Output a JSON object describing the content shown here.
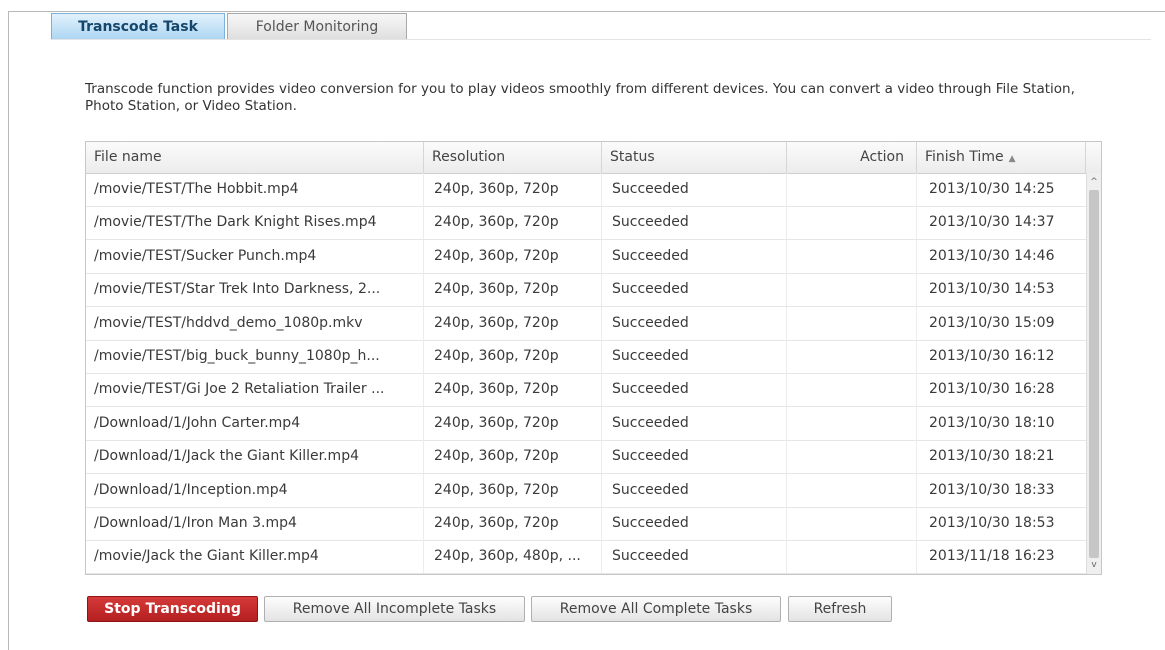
{
  "tabs": {
    "transcode_task": "Transcode Task",
    "folder_monitoring": "Folder Monitoring"
  },
  "description": "Transcode function provides video conversion for you to play videos smoothly from different devices. You can convert a video through File Station, Photo Station, or Video Station.",
  "table": {
    "columns": {
      "file_name": "File name",
      "resolution": "Resolution",
      "status": "Status",
      "action": "Action",
      "finish_time": "Finish Time"
    },
    "sort_indicator": "▲",
    "rows": [
      {
        "file": "/movie/TEST/The Hobbit.mp4",
        "resolution": "240p, 360p, 720p",
        "status": "Succeeded",
        "action": "",
        "finish": "2013/10/30 14:25"
      },
      {
        "file": "/movie/TEST/The Dark Knight Rises.mp4",
        "resolution": "240p, 360p, 720p",
        "status": "Succeeded",
        "action": "",
        "finish": "2013/10/30 14:37"
      },
      {
        "file": "/movie/TEST/Sucker Punch.mp4",
        "resolution": "240p, 360p, 720p",
        "status": "Succeeded",
        "action": "",
        "finish": "2013/10/30 14:46"
      },
      {
        "file": "/movie/TEST/Star Trek Into Darkness, 2...",
        "resolution": "240p, 360p, 720p",
        "status": "Succeeded",
        "action": "",
        "finish": "2013/10/30 14:53"
      },
      {
        "file": "/movie/TEST/hddvd_demo_1080p.mkv",
        "resolution": "240p, 360p, 720p",
        "status": "Succeeded",
        "action": "",
        "finish": "2013/10/30 15:09"
      },
      {
        "file": "/movie/TEST/big_buck_bunny_1080p_h...",
        "resolution": "240p, 360p, 720p",
        "status": "Succeeded",
        "action": "",
        "finish": "2013/10/30 16:12"
      },
      {
        "file": "/movie/TEST/Gi Joe 2 Retaliation Trailer ...",
        "resolution": "240p, 360p, 720p",
        "status": "Succeeded",
        "action": "",
        "finish": "2013/10/30 16:28"
      },
      {
        "file": "/Download/1/John Carter.mp4",
        "resolution": "240p, 360p, 720p",
        "status": "Succeeded",
        "action": "",
        "finish": "2013/10/30 18:10"
      },
      {
        "file": "/Download/1/Jack the Giant Killer.mp4",
        "resolution": "240p, 360p, 720p",
        "status": "Succeeded",
        "action": "",
        "finish": "2013/10/30 18:21"
      },
      {
        "file": "/Download/1/Inception.mp4",
        "resolution": "240p, 360p, 720p",
        "status": "Succeeded",
        "action": "",
        "finish": "2013/10/30 18:33"
      },
      {
        "file": "/Download/1/Iron Man 3.mp4",
        "resolution": "240p, 360p, 720p",
        "status": "Succeeded",
        "action": "",
        "finish": "2013/10/30 18:53"
      },
      {
        "file": "/movie/Jack the Giant Killer.mp4",
        "resolution": "240p, 360p, 480p, ...",
        "status": "Succeeded",
        "action": "",
        "finish": "2013/11/18 16:23"
      }
    ]
  },
  "scrollbar": {
    "up_icon": "^",
    "down_icon": "v"
  },
  "buttons": {
    "stop_transcoding": "Stop Transcoding",
    "remove_incomplete": "Remove All Incomplete Tasks",
    "remove_complete": "Remove All Complete Tasks",
    "refresh": "Refresh"
  },
  "colors": {
    "active_tab": "#abd5f2",
    "danger_button": "#c42b2b"
  }
}
